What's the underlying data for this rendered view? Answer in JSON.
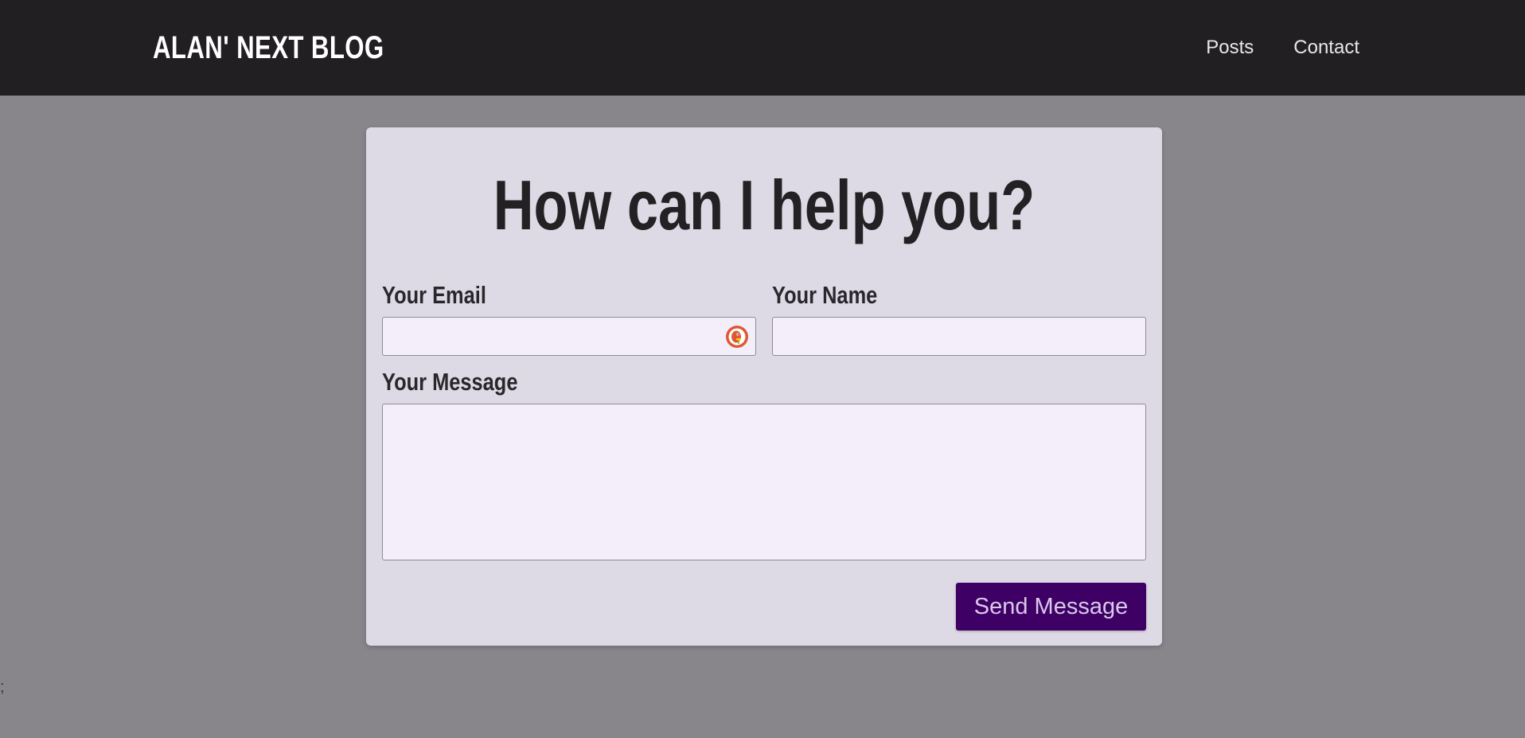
{
  "header": {
    "logo_text": "ALAN' NEXT BLOG",
    "nav": [
      {
        "label": "Posts"
      },
      {
        "label": "Contact"
      }
    ]
  },
  "contact_form": {
    "title": "How can I help you?",
    "email_label": "Your Email",
    "email_value": "",
    "name_label": "Your Name",
    "name_value": "",
    "message_label": "Your Message",
    "message_value": "",
    "submit_label": "Send Message"
  },
  "page": {
    "stray_text": ";"
  },
  "colors": {
    "header_bg": "#211f22",
    "page_bg": "#88858b",
    "card_bg": "#dedae5",
    "input_bg": "#f3eef9",
    "button_bg": "#3f0065",
    "button_text": "#d9c9ea"
  },
  "icons": {
    "email_field_icon": "duckduckgo-icon"
  }
}
